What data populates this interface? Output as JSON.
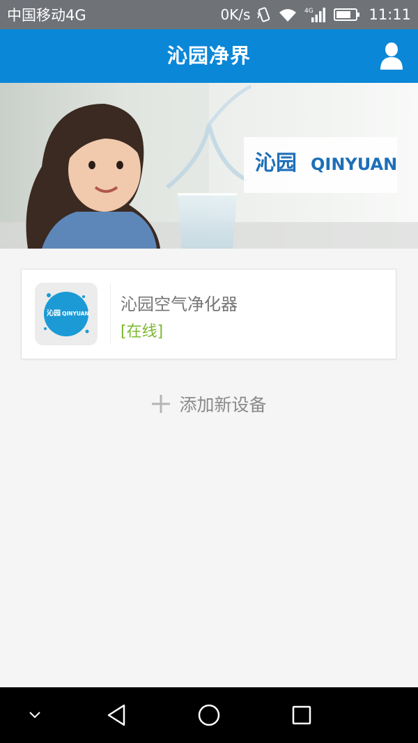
{
  "status_bar": {
    "carrier": "中国移动4G",
    "speed": "0K/s",
    "network_badge": "4G",
    "time": "11:11"
  },
  "app_bar": {
    "title": "沁园净界",
    "user_icon": "person-icon"
  },
  "banner": {
    "brand_cn": "沁园",
    "brand_en": "QINYUAN"
  },
  "devices": [
    {
      "name": "沁园空气净化器",
      "status": "[在线]",
      "logo_cn": "沁园",
      "logo_en": "QINYUAN"
    }
  ],
  "add_device": {
    "label": "添加新设备",
    "icon": "plus-icon"
  },
  "nav_bar": {
    "items": [
      "chevron-down-icon",
      "back-icon",
      "home-icon",
      "recents-icon"
    ]
  },
  "colors": {
    "app_bar": "#0b87d8",
    "status_online": "#7cb82f",
    "status_bar": "#6f7378"
  }
}
